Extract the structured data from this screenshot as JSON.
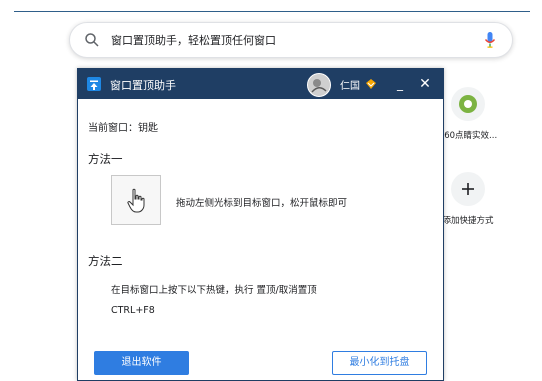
{
  "search": {
    "text": "窗口置顶助手，轻松置顶任何窗口"
  },
  "shortcuts": [
    {
      "label": "360点睛实效...",
      "icon": "green-circle-icon"
    },
    {
      "label": "添加快捷方式",
      "icon": "plus-icon"
    }
  ],
  "dialog": {
    "title": "窗口置顶助手",
    "username": "仁国",
    "min_label": "_",
    "close_label": "✕",
    "current_window": "当前窗口：钥匙",
    "method1_title": "方法一",
    "drag_instruction": "拖动左侧光标到目标窗口，松开鼠标即可",
    "method2_title": "方法二",
    "hotkey_instruction": "在目标窗口上按下以下热键，执行 置顶/取消置顶",
    "hotkey": "CTRL+F8",
    "exit_button": "退出软件",
    "tray_button": "最小化到托盘"
  },
  "colors": {
    "titlebar": "#1f3e64",
    "accent": "#2f7de1",
    "vip": "#f7a600"
  }
}
